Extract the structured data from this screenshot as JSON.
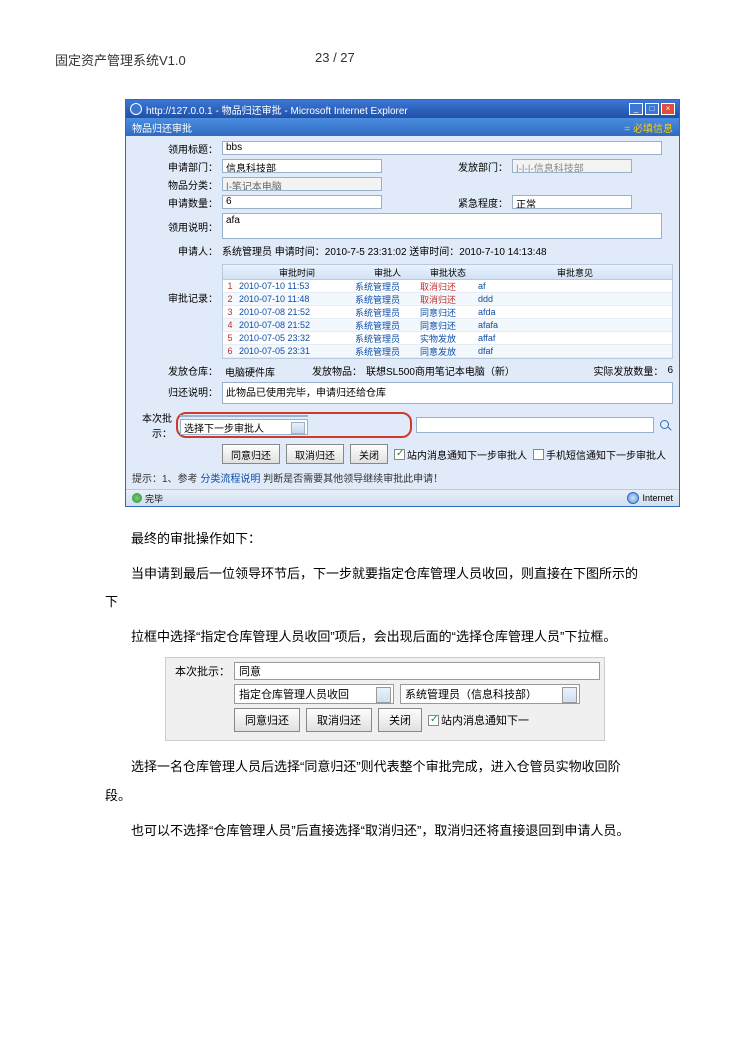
{
  "page": {
    "header_left": "固定资产管理系统V1.0",
    "header_center": "23 / 27"
  },
  "ie": {
    "title": "http://127.0.0.1 - 物品归还审批 - Microsoft Internet Explorer",
    "panel_title": "物品归还审批",
    "req_info": "= 必填信息",
    "form": {
      "title_label": "领用标题：",
      "title_value": "bbs",
      "dept_label": "申请部门：",
      "dept_value": "信息科技部",
      "issue_dept_label": "发放部门：",
      "issue_dept_value": "|-|-|-信息科技部",
      "cat_label": "物品分类：",
      "cat_value": "|-笔记本电脑",
      "qty_label": "申请数量：",
      "qty_value": "6",
      "urgency_label": "紧急程度：",
      "urgency_value": "正常",
      "note_label": "领用说明：",
      "note_value": "afa",
      "applicant_label": "申请人：",
      "applicant_line": "系统管理员  申请时间：2010-7-5 23:31:02  送审时间：2010-7-10 14:13:48"
    },
    "records": {
      "label": "审批记录：",
      "head": {
        "n": "",
        "time": "审批时间",
        "person": "审批人",
        "status": "审批状态",
        "opinion": "审批意见"
      },
      "rows": [
        {
          "n": "1",
          "time": "2010-07-10 11:53",
          "person": "系统管理员",
          "status": "取消归还",
          "agree": false,
          "opinion": "af"
        },
        {
          "n": "2",
          "time": "2010-07-10 11:48",
          "person": "系统管理员",
          "status": "取消归还",
          "agree": false,
          "opinion": "ddd"
        },
        {
          "n": "3",
          "time": "2010-07-08 21:52",
          "person": "系统管理员",
          "status": "同意归还",
          "agree": true,
          "opinion": "afda"
        },
        {
          "n": "4",
          "time": "2010-07-08 21:52",
          "person": "系统管理员",
          "status": "同意归还",
          "agree": true,
          "opinion": "afafa"
        },
        {
          "n": "5",
          "time": "2010-07-05 23:32",
          "person": "系统管理员",
          "status": "实物发放",
          "agree": true,
          "opinion": "affaf"
        },
        {
          "n": "6",
          "time": "2010-07-05 23:31",
          "person": "系统管理员",
          "status": "同意发放",
          "agree": true,
          "opinion": "dfaf"
        }
      ]
    },
    "issue": {
      "wh_label": "发放仓库：",
      "wh_value": "电脑硬件库",
      "goods_label": "发放物品：",
      "goods_value": "联想SL500商用笔记本电脑（新）",
      "actual_label": "实际发放数量：",
      "actual_value": "6",
      "ret_label": "归还说明：",
      "ret_value": "此物品已使用完毕，申请归还给仓库"
    },
    "this_approval": {
      "label": "本次批示：",
      "combo": "选择下一步审批人"
    },
    "btns": {
      "agree": "同意归还",
      "cancel": "取消归还",
      "close": "关闭",
      "notify1": "站内消息通知下一步审批人",
      "notify2": "手机短信通知下一步审批人"
    },
    "hint": {
      "prefix": "提示：1、参考 ",
      "link": "分类流程说明",
      "suffix": " 判断是否需要其他领导继续审批此申请！"
    },
    "status": {
      "done": "完毕",
      "internet": "Internet"
    }
  },
  "body": {
    "p1": "最终的审批操作如下：",
    "p2": "当申请到最后一位领导环节后，下一步就要指定仓库管理人员收回，则直接在下图所示的下",
    "p3": "拉框中选择“指定仓库管理人员收回”项后，会出现后面的“选择仓库管理人员”下拉框。",
    "p4": "选择一名仓库管理人员后选择“同意归还”则代表整个审批完成，进入仓管员实物收回阶段。",
    "p5": "也可以不选择“仓库管理人员”后直接选择“取消归还”，取消归还将直接退回到申请人员。"
  },
  "snippet2": {
    "label": "本次批示：",
    "input_value": "同意",
    "combo1": "指定仓库管理人员收回",
    "combo2": "系统管理员（信息科技部）",
    "btn_agree": "同意归还",
    "btn_cancel": "取消归还",
    "btn_close": "关闭",
    "notify": "站内消息通知下一"
  }
}
